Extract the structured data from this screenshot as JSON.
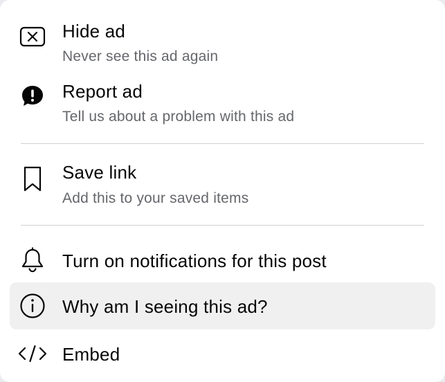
{
  "menu": {
    "items": [
      {
        "title": "Hide ad",
        "subtitle": "Never see this ad again",
        "icon": "close-box-icon"
      },
      {
        "title": "Report ad",
        "subtitle": "Tell us about a problem with this ad",
        "icon": "report-alert-icon"
      },
      {
        "title": "Save link",
        "subtitle": "Add this to your saved items",
        "icon": "bookmark-icon"
      },
      {
        "title": "Turn on notifications for this post",
        "icon": "bell-icon"
      },
      {
        "title": "Why am I seeing this ad?",
        "icon": "info-icon",
        "highlighted": true
      },
      {
        "title": "Embed",
        "icon": "code-icon"
      }
    ]
  },
  "colors": {
    "background": "#ffffff",
    "text_primary": "#050505",
    "text_secondary": "#65676b",
    "divider": "#ced0d4",
    "hover": "#f0f0f0"
  }
}
